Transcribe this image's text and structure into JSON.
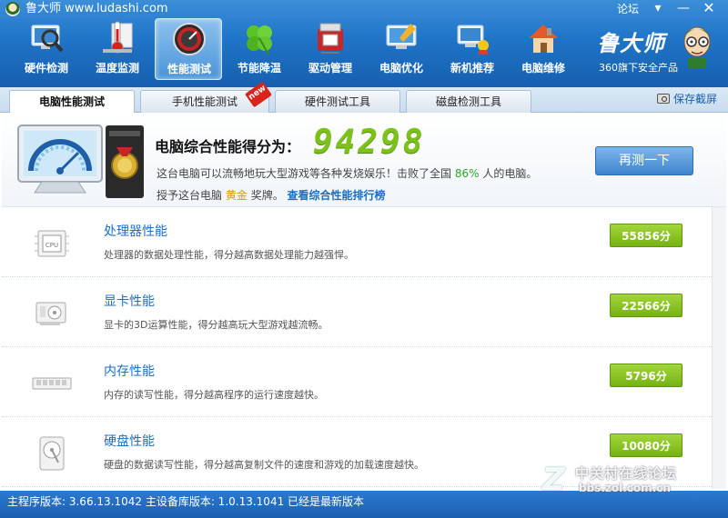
{
  "window": {
    "title": "鲁大师 www.ludashi.com",
    "forum": "论坛",
    "menu_glyph": "▾",
    "min_glyph": "—",
    "close_glyph": "✕"
  },
  "toolbar": {
    "items": [
      {
        "label": "硬件检测",
        "icon": "hardware-scan-icon"
      },
      {
        "label": "温度监测",
        "icon": "thermometer-icon"
      },
      {
        "label": "性能测试",
        "icon": "speedometer-icon",
        "active": true
      },
      {
        "label": "节能降温",
        "icon": "clover-icon"
      },
      {
        "label": "驱动管理",
        "icon": "driver-chip-icon"
      },
      {
        "label": "电脑优化",
        "icon": "optimize-monitor-icon"
      },
      {
        "label": "新机推荐",
        "icon": "new-pc-icon"
      },
      {
        "label": "电脑维修",
        "icon": "repair-house-icon"
      }
    ]
  },
  "brand": {
    "name": "鲁大师",
    "subtitle": "360旗下安全产品"
  },
  "tabs": [
    {
      "label": "电脑性能测试",
      "active": true
    },
    {
      "label": "手机性能测试"
    },
    {
      "label": "硬件测试工具"
    },
    {
      "label": "磁盘检测工具"
    }
  ],
  "badge_new": "new",
  "screenshot_label": "保存截屏",
  "summary": {
    "score_label": "电脑综合性能得分为：",
    "score": "94298",
    "desc_prefix": "这台电脑可以流畅地玩大型游戏等各种发烧娱乐！击败了全国",
    "beat_percent": "86%",
    "desc_suffix": "人的电脑。",
    "award_prefix": "授予这台电脑",
    "medal": "黄金",
    "award_suffix": "奖牌。",
    "rank_link": "查看综合性能排行榜",
    "retest_button": "再测一下"
  },
  "rows": [
    {
      "title": "处理器性能",
      "desc": "处理器的数据处理性能，得分越高数据处理能力越强悍。",
      "score": "55856分",
      "icon": "cpu-icon"
    },
    {
      "title": "显卡性能",
      "desc": "显卡的3D运算性能，得分越高玩大型游戏越流畅。",
      "score": "22566分",
      "icon": "graphics-card-icon"
    },
    {
      "title": "内存性能",
      "desc": "内存的读写性能，得分越高程序的运行速度越快。",
      "score": "5796分",
      "icon": "memory-icon"
    },
    {
      "title": "硬盘性能",
      "desc": "硬盘的数据读写性能，得分越高复制文件的速度和游戏的加载速度越快。",
      "score": "10080分",
      "icon": "hard-disk-icon"
    }
  ],
  "status": {
    "text": "主程序版本: 3.66.13.1042   主设备库版本: 1.0.13.1041   已经是最新版本"
  },
  "watermark": {
    "logo": "Z",
    "name": "中关村在线论坛",
    "url": "bbs.zol.com.cn"
  },
  "colors": {
    "score_green": "#7cc21b",
    "titlebar_blue": "#1f74c7",
    "link_blue": "#1b6fc4"
  }
}
